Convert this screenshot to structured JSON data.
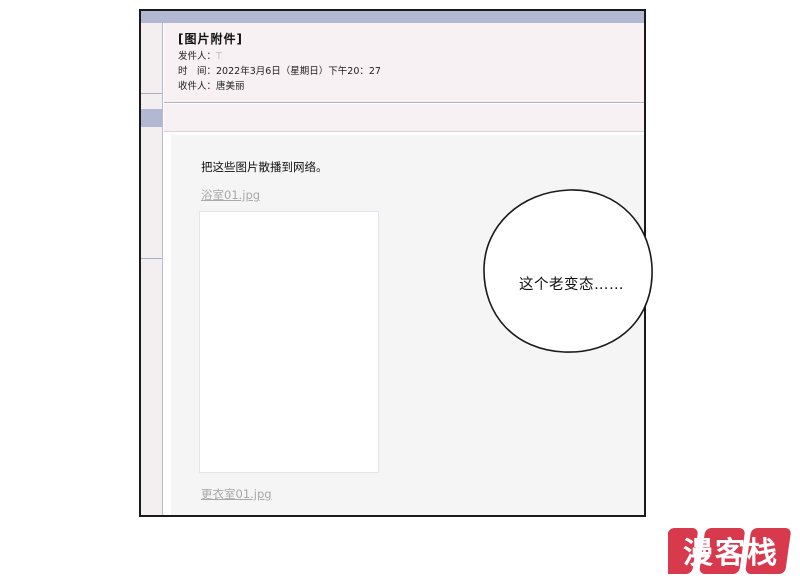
{
  "mail": {
    "subject": "[图片附件]",
    "sender_label": "发件人：",
    "sender_value": "T",
    "time_label": "时　间：",
    "time_value": "2022年3月6日（星期日）下午20：27",
    "recipient_label": "收件人：",
    "recipient_value": "唐美丽",
    "body_text": "把这些图片散播到网络。",
    "attachments": [
      {
        "name": "浴室01.jpg"
      },
      {
        "name": "更衣室01.jpg"
      }
    ]
  },
  "speech_bubble": {
    "text": "这个老变态……"
  },
  "watermark": {
    "logo": "漫客栈"
  },
  "colors": {
    "accent": "#b3b8d2",
    "header_bg": "#f7f1f3",
    "body_bg": "#f5f5f5",
    "link_gray": "#a8a8a8",
    "watermark_red": "#d9394d"
  },
  "icons": []
}
